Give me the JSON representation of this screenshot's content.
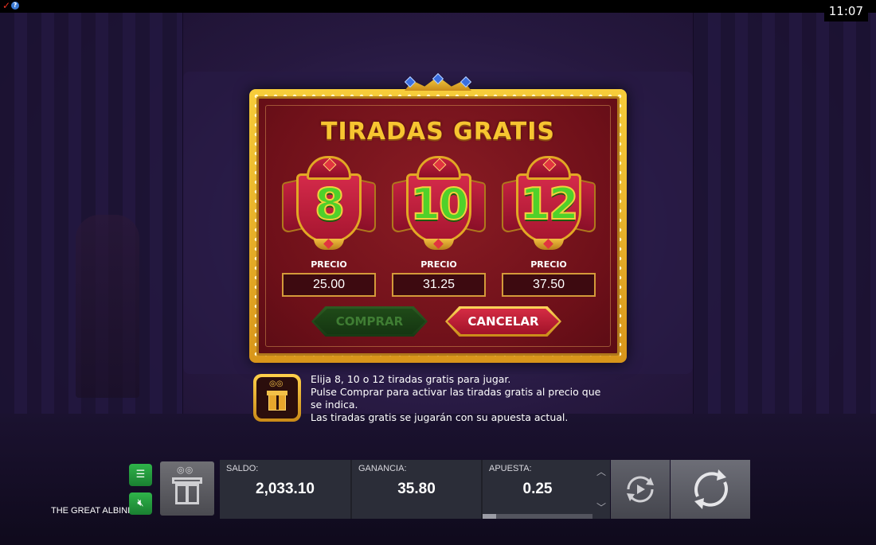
{
  "status_bar": {
    "clock": "11:07"
  },
  "dialog": {
    "title": "TIRADAS GRATIS",
    "options": [
      {
        "spins": "8",
        "price_label": "PRECIO",
        "price": "25.00"
      },
      {
        "spins": "10",
        "price_label": "PRECIO",
        "price": "31.25"
      },
      {
        "spins": "12",
        "price_label": "PRECIO",
        "price": "37.50"
      }
    ],
    "buy_label": "COMPRAR",
    "cancel_label": "CANCELAR"
  },
  "info": {
    "line1": "Elija 8, 10 o 12 tiradas gratis para jugar.",
    "line2": "Pulse Comprar para activar las tiradas gratis al precio que se indica.",
    "line3": "Las tiradas gratis se jugarán con su apuesta actual."
  },
  "bottom_bar": {
    "game_name": "THE GREAT ALBINI",
    "balance_label": "SALDO:",
    "balance": "2,033.10",
    "win_label": "GANANCIA:",
    "win": "35.80",
    "bet_label": "APUESTA:",
    "bet": "0.25",
    "bet_level_fraction": 0.12
  },
  "colors": {
    "gold": "#f7c531",
    "spin_number_green": "#4fd12a",
    "dialog_red": "#7a1420",
    "cancel_red": "#d52c44",
    "buy_green_disabled": "#1f4a18",
    "menu_green": "#2fb44a"
  },
  "icons": {
    "menu": "menu-icon",
    "sound": "sound-muted-icon",
    "gift": "gift-icon",
    "autoplay": "autoplay-icon",
    "spin": "spin-icon",
    "bet_up": "chevron-up-icon",
    "bet_down": "chevron-down-icon"
  }
}
